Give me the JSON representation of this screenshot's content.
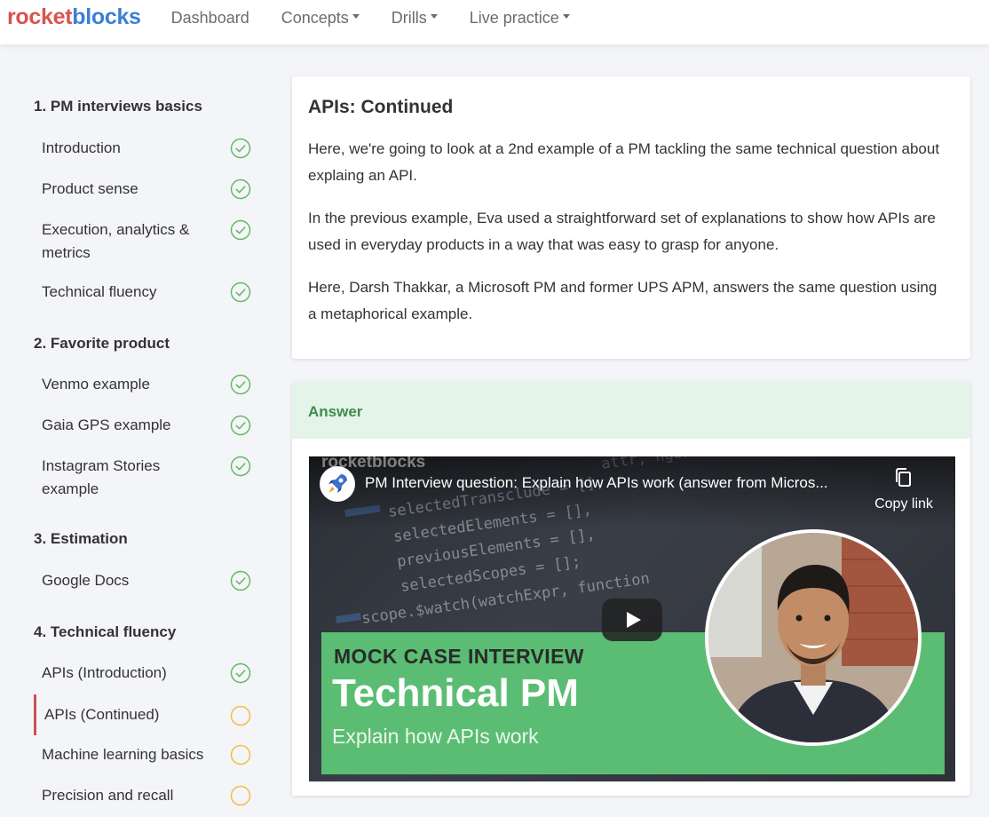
{
  "navbar": {
    "logo_part1": "rocket",
    "logo_part2": "blocks",
    "items": [
      {
        "label": "Dashboard",
        "dropdown": false
      },
      {
        "label": "Concepts",
        "dropdown": true
      },
      {
        "label": "Drills",
        "dropdown": true
      },
      {
        "label": "Live practice",
        "dropdown": true
      }
    ]
  },
  "sidebar": {
    "sections": [
      {
        "heading": "1. PM interviews basics",
        "items": [
          {
            "label": "Introduction",
            "status": "complete"
          },
          {
            "label": "Product sense",
            "status": "complete"
          },
          {
            "label": "Execution, analytics & metrics",
            "status": "complete"
          },
          {
            "label": "Technical fluency",
            "status": "complete"
          }
        ]
      },
      {
        "heading": "2. Favorite product",
        "items": [
          {
            "label": "Venmo example",
            "status": "complete"
          },
          {
            "label": "Gaia GPS example",
            "status": "complete"
          },
          {
            "label": "Instagram Stories example",
            "status": "complete"
          }
        ]
      },
      {
        "heading": "3. Estimation",
        "items": [
          {
            "label": "Google Docs",
            "status": "complete"
          }
        ]
      },
      {
        "heading": "4. Technical fluency",
        "items": [
          {
            "label": "APIs (Introduction)",
            "status": "complete"
          },
          {
            "label": "APIs (Continued)",
            "status": "incomplete",
            "active": true
          },
          {
            "label": "Machine learning basics",
            "status": "incomplete"
          },
          {
            "label": "Precision and recall",
            "status": "incomplete"
          }
        ]
      }
    ]
  },
  "main": {
    "title": "APIs: Continued",
    "paragraphs": [
      "Here, we're going to look at a 2nd example of a PM tackling the same technical question about explaing an API.",
      "In the previous example, Eva used a straightforward set of explanations to show how APIs are used in everyday products in a way that was easy to grasp for anyone.",
      "Here, Darsh Thakkar, a Microsoft PM and former UPS APM, answers the same question using a metaphorical example."
    ],
    "answer_label": "Answer",
    "video": {
      "title": "PM Interview question: Explain how APIs work (answer from Micros...",
      "copy_link": "Copy link",
      "watermark": "rocketblocks",
      "banner_line1": "MOCK CASE INTERVIEW",
      "banner_line2": "Technical PM",
      "banner_line3": "Explain how APIs work"
    }
  },
  "colors": {
    "logo_rocket": "#d9534f",
    "logo_blocks": "#3c7fd6",
    "complete_icon": "#5cb85c",
    "incomplete_icon": "#f0c040",
    "active_marker": "#c9514e",
    "answer_header_bg": "#e5f4e8",
    "answer_header_text": "#3d8b4f",
    "video_banner": "#5bbd73"
  },
  "icons": {
    "complete": "check-circle-icon",
    "incomplete": "empty-circle-icon",
    "copy": "copy-icon",
    "play": "play-icon",
    "channel": "rocket-icon"
  }
}
